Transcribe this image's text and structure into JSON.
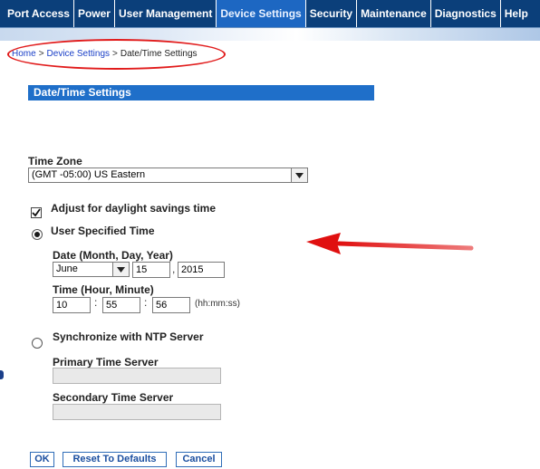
{
  "nav": {
    "items": [
      {
        "label": "Port Access",
        "active": false
      },
      {
        "label": "Power",
        "active": false
      },
      {
        "label": "User Management",
        "active": false
      },
      {
        "label": "Device Settings",
        "active": true
      },
      {
        "label": "Security",
        "active": false
      },
      {
        "label": "Maintenance",
        "active": false
      },
      {
        "label": "Diagnostics",
        "active": false
      },
      {
        "label": "Help",
        "active": false
      }
    ]
  },
  "breadcrumb": {
    "home": "Home",
    "device_settings": "Device Settings",
    "current": "Date/Time Settings",
    "separator": ">"
  },
  "section": {
    "title": "Date/Time Settings"
  },
  "timezone": {
    "label": "Time Zone",
    "selected": "(GMT -05:00) US Eastern"
  },
  "dst": {
    "label": "Adjust for daylight savings time",
    "checked": true
  },
  "user_time": {
    "label": "User Specified Time",
    "selected": true,
    "date_label": "Date (Month, Day, Year)",
    "month": "June",
    "day": "15",
    "year": "2015",
    "date_sep": ",",
    "time_label": "Time (Hour, Minute)",
    "hour": "10",
    "minute": "55",
    "second": "56",
    "time_sep": ":",
    "time_hint": "(hh:mm:ss)"
  },
  "ntp": {
    "label": "Synchronize with NTP Server",
    "selected": false,
    "primary_label": "Primary Time Server",
    "primary_value": "",
    "secondary_label": "Secondary Time Server",
    "secondary_value": ""
  },
  "buttons": {
    "ok": "OK",
    "reset": "Reset To Defaults",
    "cancel": "Cancel"
  },
  "colors": {
    "nav_bg": "#0b3f7a",
    "nav_active": "#1d67c2",
    "section_header": "#1f6fc9",
    "annotation": "#e11b1b"
  }
}
